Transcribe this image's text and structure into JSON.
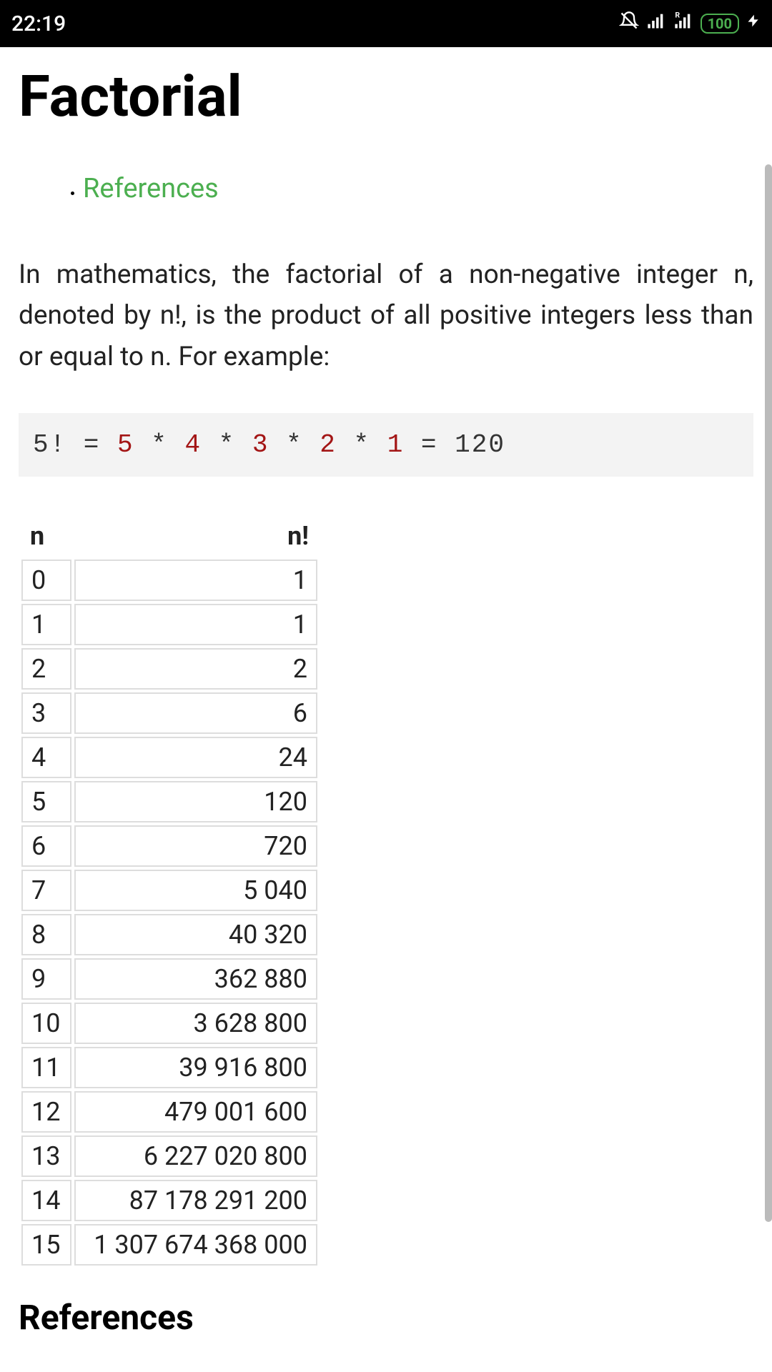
{
  "status_bar": {
    "time": "22:19",
    "battery": "100"
  },
  "page": {
    "title": "Factorial",
    "toc": {
      "references": "References"
    },
    "intro": "In mathematics, the factorial of a non-negative integer n, denoted by n!, is the product of all positive integers less than or equal to n. For example:",
    "code_prefix": "5! = ",
    "code_nums": [
      "5",
      "4",
      "3",
      "2",
      "1"
    ],
    "code_suffix": " = 120",
    "table": {
      "header_n": "n",
      "header_nf": "n!",
      "rows": [
        {
          "n": "0",
          "nf": "1"
        },
        {
          "n": "1",
          "nf": "1"
        },
        {
          "n": "2",
          "nf": "2"
        },
        {
          "n": "3",
          "nf": "6"
        },
        {
          "n": "4",
          "nf": "24"
        },
        {
          "n": "5",
          "nf": "120"
        },
        {
          "n": "6",
          "nf": "720"
        },
        {
          "n": "7",
          "nf": "5 040"
        },
        {
          "n": "8",
          "nf": "40 320"
        },
        {
          "n": "9",
          "nf": "362 880"
        },
        {
          "n": "10",
          "nf": "3 628 800"
        },
        {
          "n": "11",
          "nf": "39 916 800"
        },
        {
          "n": "12",
          "nf": "479 001 600"
        },
        {
          "n": "13",
          "nf": "6 227 020 800"
        },
        {
          "n": "14",
          "nf": "87 178 291 200"
        },
        {
          "n": "15",
          "nf": "1 307 674 368 000"
        }
      ]
    },
    "references_heading": "References"
  }
}
